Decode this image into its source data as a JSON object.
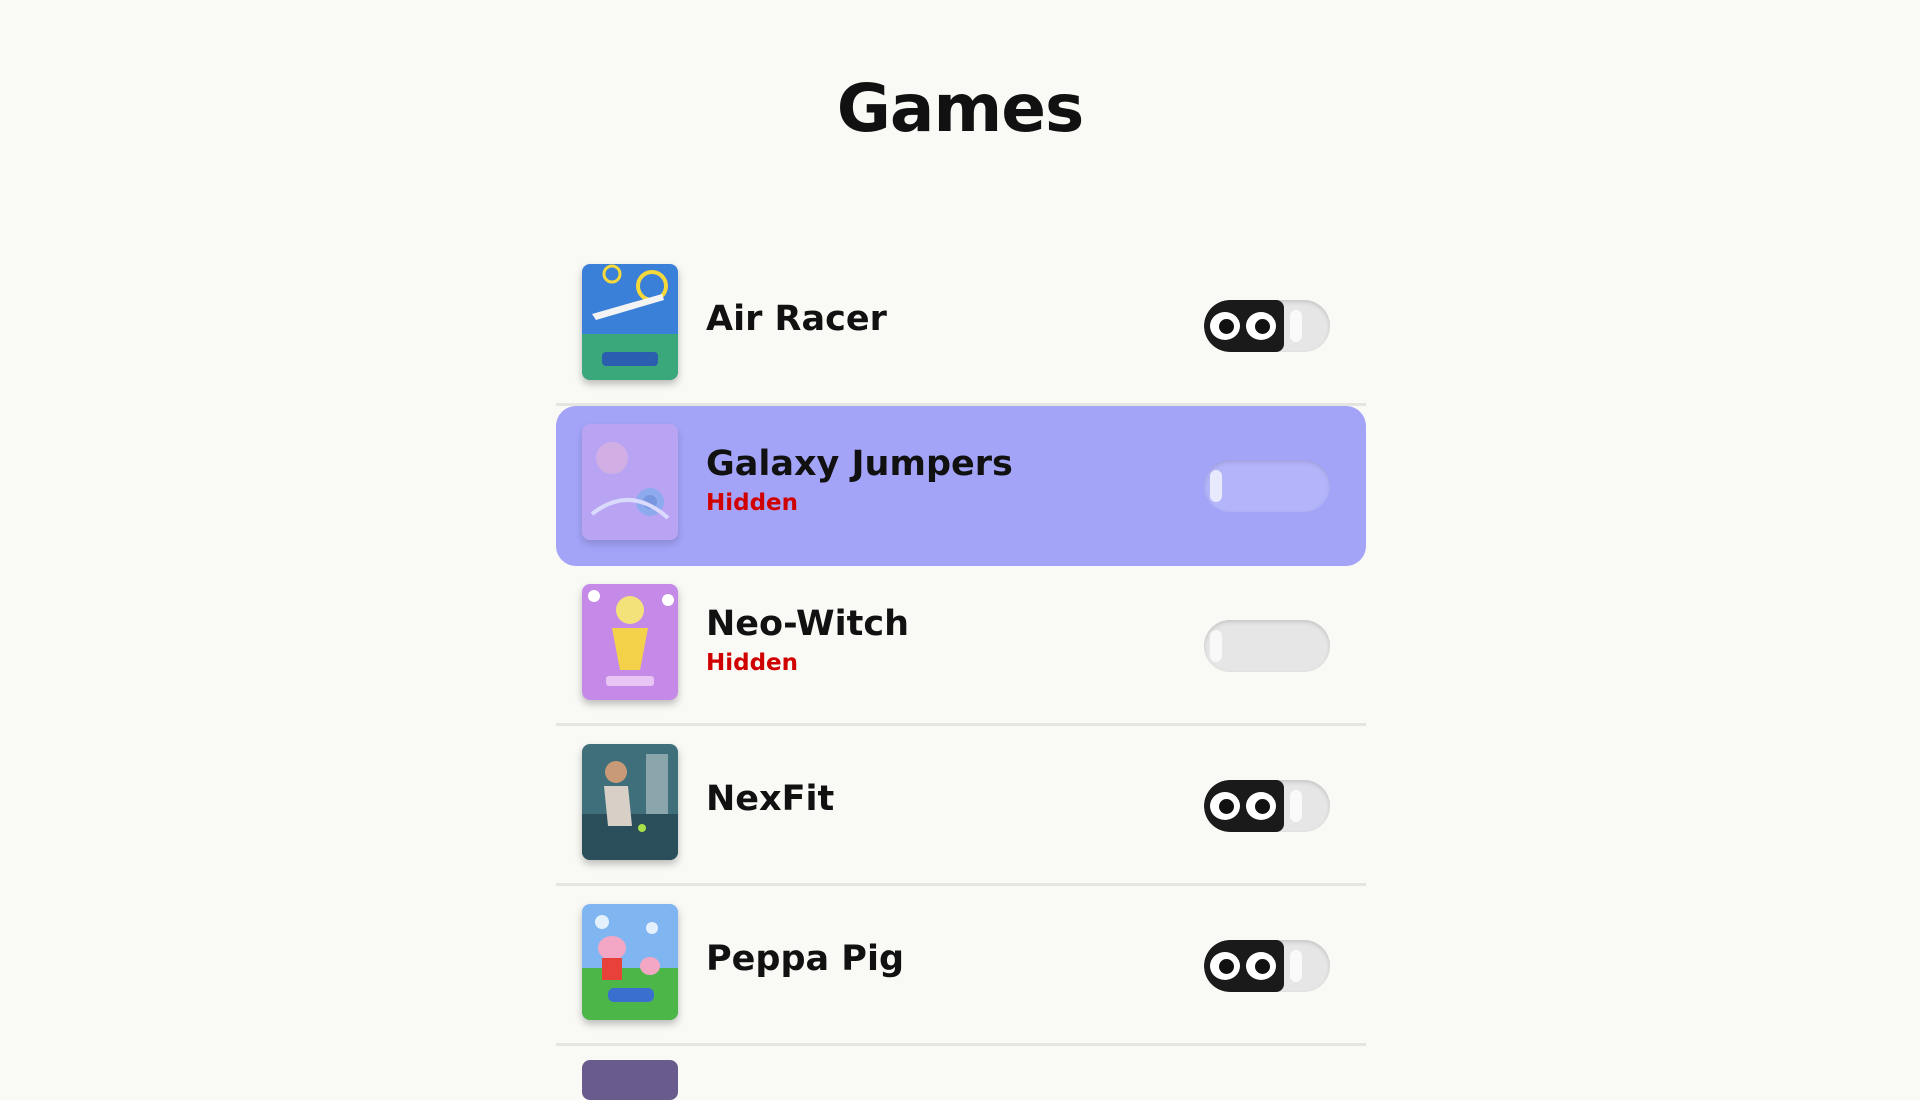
{
  "page": {
    "title": "Games",
    "background": "#f9f9f5",
    "focus_color": "#a3a3f8",
    "hidden_color": "#d00000"
  },
  "games": [
    {
      "name": "Air Racer",
      "status": "",
      "visible": true,
      "icon": "air-racer-thumbnail"
    },
    {
      "name": "Galaxy Jumpers",
      "status": "Hidden",
      "visible": false,
      "focused": true,
      "icon": "galaxy-jumpers-thumbnail"
    },
    {
      "name": "Neo-Witch",
      "status": "Hidden",
      "visible": false,
      "icon": "neo-witch-thumbnail"
    },
    {
      "name": "NexFit",
      "status": "",
      "visible": true,
      "icon": "nexfit-thumbnail"
    },
    {
      "name": "Peppa Pig",
      "status": "",
      "visible": true,
      "icon": "peppa-pig-thumbnail"
    }
  ]
}
